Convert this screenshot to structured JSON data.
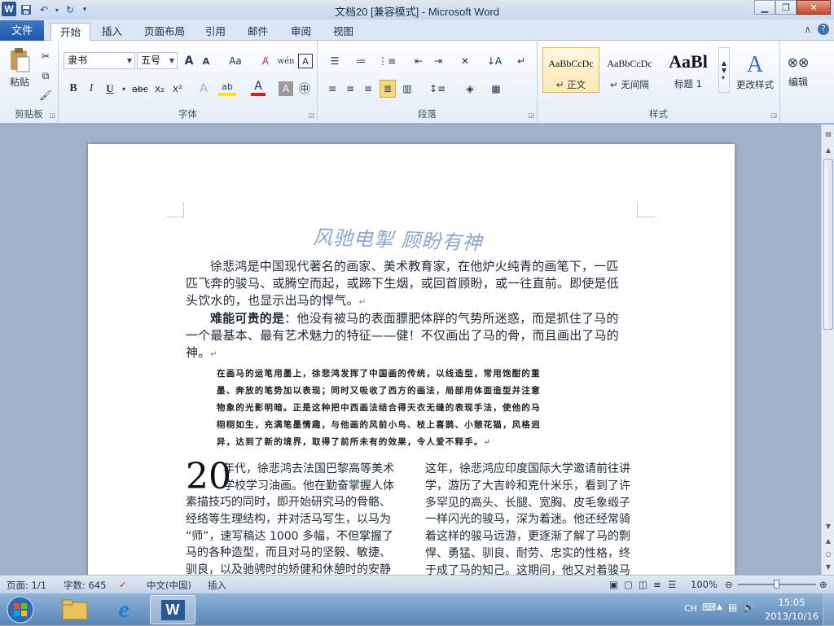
{
  "window": {
    "title": "文档20 [兼容模式] - Microsoft Word",
    "app_letter": "W"
  },
  "ribbon_tabs": {
    "file": "文件",
    "tabs": [
      "开始",
      "插入",
      "页面布局",
      "引用",
      "邮件",
      "审阅",
      "视图"
    ]
  },
  "clipboard": {
    "paste": "粘贴",
    "group": "剪贴板"
  },
  "font": {
    "name": "隶书",
    "size": "五号",
    "group": "字体",
    "grow": "A",
    "shrink": "A",
    "case": "Aa",
    "bold": "B",
    "italic": "I",
    "underline": "U",
    "strike": "abc",
    "sub": "x₂",
    "sup": "x²",
    "color_letter": "A",
    "border_letter": "A",
    "phonetic": "wén",
    "highlight_letter": "ab"
  },
  "paragraph": {
    "group": "段落"
  },
  "styles": {
    "group": "样式",
    "items": [
      {
        "preview": "AaBbCcDc",
        "name": "↵ 正文"
      },
      {
        "preview": "AaBbCcDc",
        "name": "↵ 无间隔"
      },
      {
        "preview": "AaBl",
        "name": "标题 1"
      }
    ],
    "change": "更改样式"
  },
  "editing": {
    "label": "编辑"
  },
  "document": {
    "wordart": "风驰电掣 顾盼有神",
    "para1_lines": [
      "徐悲鸿是中国现代著名的画家、美术教育家，在他炉火纯青的画笔下，一匹",
      "匹飞奔的骏马、或腾空而起，或蹄下生烟，或回首顾盼，或一往直前。即使是低",
      "头饮水的，也显示出马的悍气。"
    ],
    "para2_bold": "难能可贵的是",
    "para2_rest": "：他没有被马的表面膘肥体胖的气势所迷惑，而是抓住了马的",
    "para2_lines": [
      "一个最基本、最有艺术魅力的特征——健！不仅画出了马的骨，而且画出了马的",
      "神。"
    ],
    "quote_lines": [
      "在画马的运笔用墨上，徐悲鸿发挥了中国画的传统，以线造型，常用饱酣的重",
      "墨、奔放的笔势加以表现；同时又吸收了西方的画法，局部用体面造型并注意",
      "物象的光影明暗。正是这种把中西画法结合得天衣无缝的表现手法，使他的马",
      "栩栩如生，充满笔墨情趣，与他画的风前小鸟、枝上喜鹊、小憩花猫，风格迥",
      "异，达到了新的境界，取得了前所未有的效果，令人爱不释手。"
    ],
    "dropcap": "20",
    "col1_lines": [
      "年代，徐悲鸿去法国巴黎高等美术",
      "学校学习油画。他在勤奋掌握人体",
      "素描技巧的同时，即开始研究马的骨骼、",
      "经络等生理结构，并对活马写生，以马为",
      "“师”，速写稿达 1000 多幅，不但掌握了",
      "马的各种造型，而且对马的坚毅、敏捷、",
      "驯良，以及驰骋时的矫健和休憩时的安静"
    ],
    "col2_lines": [
      "这年，徐悲鸿应印度国际大学邀请前往讲",
      "学，游历了大吉岭和克什米乐，看到了许",
      "多罕见的高头、长腿、宽胸、皮毛象缎子",
      "一样闪光的骏马，深为着迷。他还经常骑",
      "着这样的骏马远游，更逐渐了解了马的剽",
      "悍、勇猛、驯良、耐劳、忠实的性格，终",
      "于成了马的知己。这期间，他又对着骏马"
    ]
  },
  "status": {
    "page": "页面: 1/1",
    "words": "字数: 645",
    "lang": "中文(中国)",
    "mode": "插入",
    "zoom": "100%"
  },
  "taskbar": {
    "lang": "CH",
    "time": "15:05",
    "date": "2013/10/16"
  },
  "colors": {
    "accent": "#2b5797",
    "wordart": "#8aa6d6"
  }
}
